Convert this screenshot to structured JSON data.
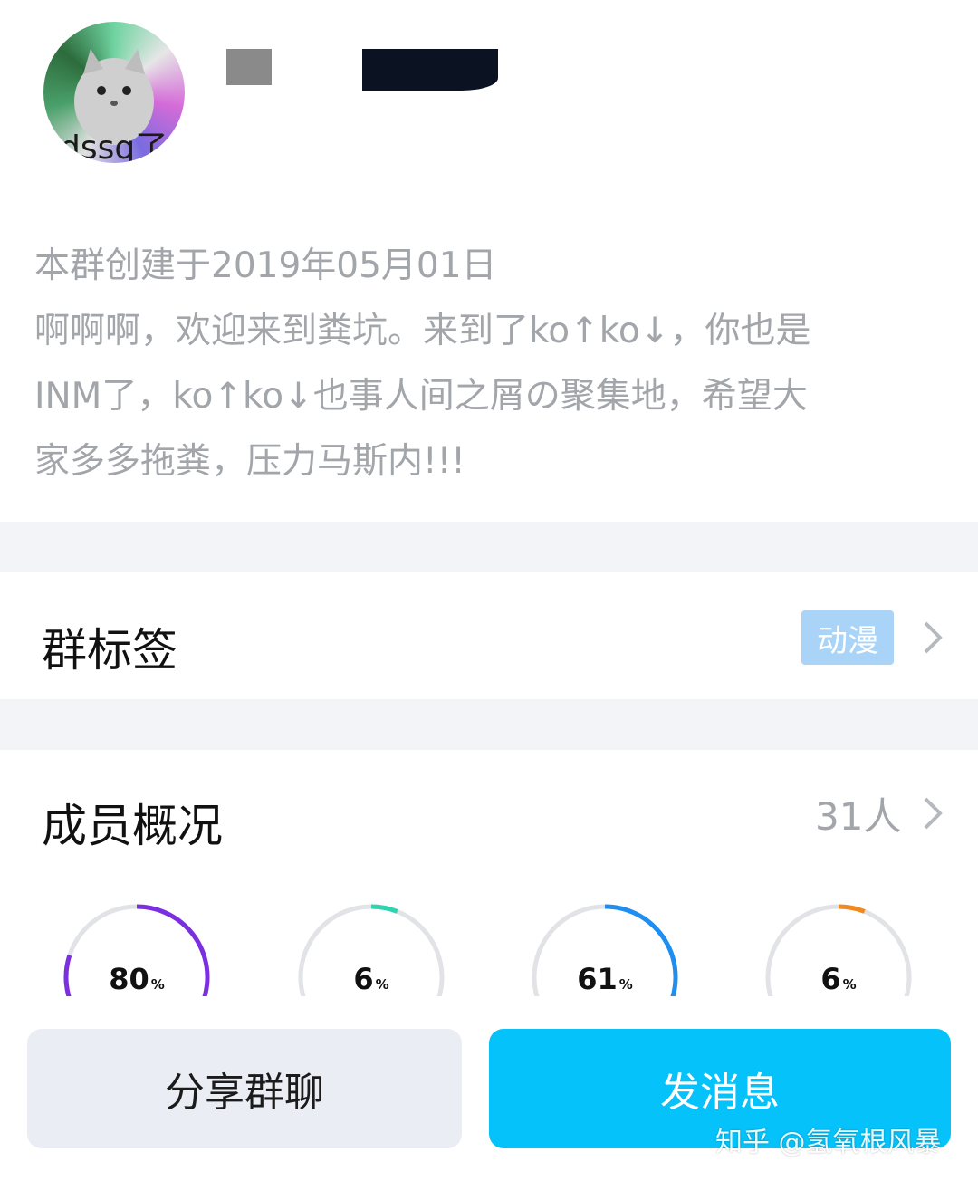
{
  "header": {
    "avatar_text": "dssq了"
  },
  "description": {
    "created": "本群创建于2019年05月01日",
    "lines": [
      "啊啊啊，欢迎来到粪坑。来到了ko↑ko↓，你也是",
      "INM了，ko↑ko↓也事人间之屑の聚集地，希望大",
      "家多多拖粪，压力马斯内!!!"
    ]
  },
  "group_tag": {
    "title": "群标签",
    "tag": "动漫"
  },
  "members": {
    "title": "成员概况",
    "count": "31人",
    "stats": [
      {
        "value": "80",
        "unit": "%",
        "fraction": 0.8,
        "color": "#7b2fe0"
      },
      {
        "value": "6",
        "unit": "%",
        "fraction": 0.06,
        "color": "#2ed3b0"
      },
      {
        "value": "61",
        "unit": "%",
        "fraction": 0.61,
        "color": "#1e8ff0"
      },
      {
        "value": "6",
        "unit": "%",
        "fraction": 0.06,
        "color": "#f08a1e"
      }
    ]
  },
  "actions": {
    "share_label": "分享群聊",
    "message_label": "发消息"
  },
  "watermark": "知乎 @氢氧根风暴",
  "colors": {
    "accent": "#05c3fa",
    "tag_bg": "#a9d3f7",
    "muted_text": "#a2a5aa",
    "section_gap": "#f3f4f7"
  }
}
